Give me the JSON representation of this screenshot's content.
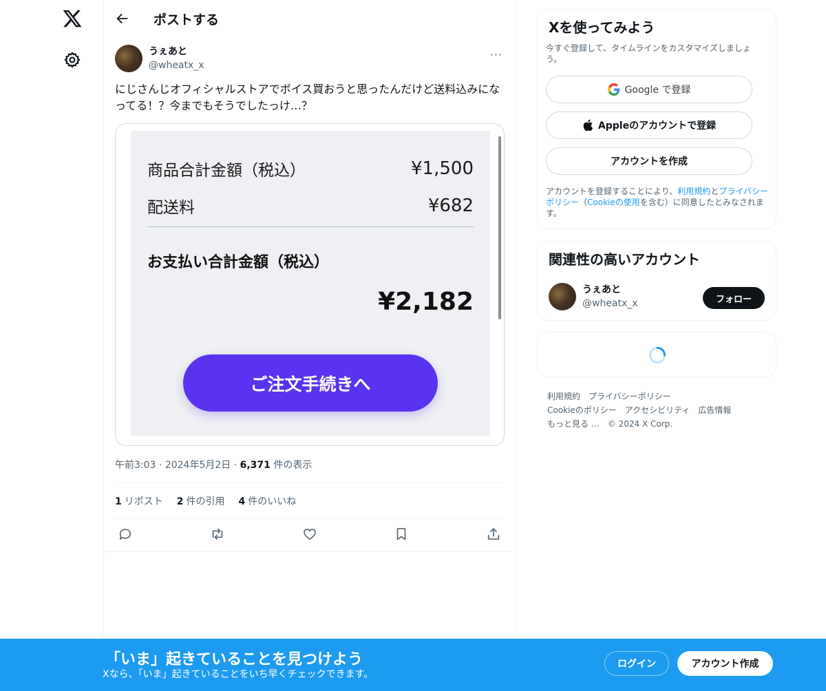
{
  "header": {
    "title": "ポストする"
  },
  "post": {
    "author_name": "うぇあと",
    "author_handle": "@wheatx_x",
    "text": "にじさんじオフィシャルストアでボイス買おうと思ったんだけど送料込みになってる！？今までもそうでしたっけ…？",
    "more": "···",
    "image": {
      "row1_label": "商品合計金額（税込）",
      "row1_value": "¥1,500",
      "row2_label": "配送料",
      "row2_value": "¥682",
      "total_label": "お支払い合計金額（税込）",
      "total_value": "¥2,182",
      "button_label": "ご注文手続きへ"
    },
    "meta": {
      "time": "午前3:03",
      "sep1": " · ",
      "date": "2024年5月2日",
      "sep2": " · ",
      "views_count": "6,371",
      "views_label": " 件の表示"
    },
    "stats": {
      "reposts_count": "1",
      "reposts_label": "リポスト",
      "quotes_count": "2",
      "quotes_label": "件の引用",
      "likes_count": "4",
      "likes_label": "件のいいね"
    }
  },
  "sidebar": {
    "signup": {
      "title": "Xを使ってみよう",
      "subtitle": "今すぐ登録して、タイムラインをカスタマイズしましょう。",
      "google_label": "Google で登録",
      "apple_label": "Appleのアカウントで登録",
      "create_label": "アカウントを作成",
      "legal_1": "アカウントを登録することにより、",
      "legal_terms": "利用規約",
      "legal_2": "と",
      "legal_privacy": "プライバシーポリシー",
      "legal_3": "（",
      "legal_cookie": "Cookieの使用",
      "legal_4": "を含む）に同意したとみなされます。"
    },
    "related": {
      "title": "関連性の高いアカウント",
      "name": "うぇあと",
      "handle": "@wheatx_x",
      "follow_label": "フォロー"
    },
    "footer": {
      "terms": "利用規約",
      "privacy": "プライバシーポリシー",
      "cookie": "Cookieのポリシー",
      "accessibility": "アクセシビリティ",
      "ads": "広告情報",
      "more": "もっと見る …",
      "copyright": "© 2024 X Corp."
    }
  },
  "banner": {
    "title": "「いま」起きていることを見つけよう",
    "subtitle": "Xなら、「いま」起きていることをいち早くチェックできます。",
    "login_label": "ログイン",
    "create_label": "アカウント作成"
  },
  "colors": {
    "accent": "#1d9bf0",
    "order_button": "#5a33f0",
    "text_primary": "#0f1419",
    "text_secondary": "#536471"
  }
}
